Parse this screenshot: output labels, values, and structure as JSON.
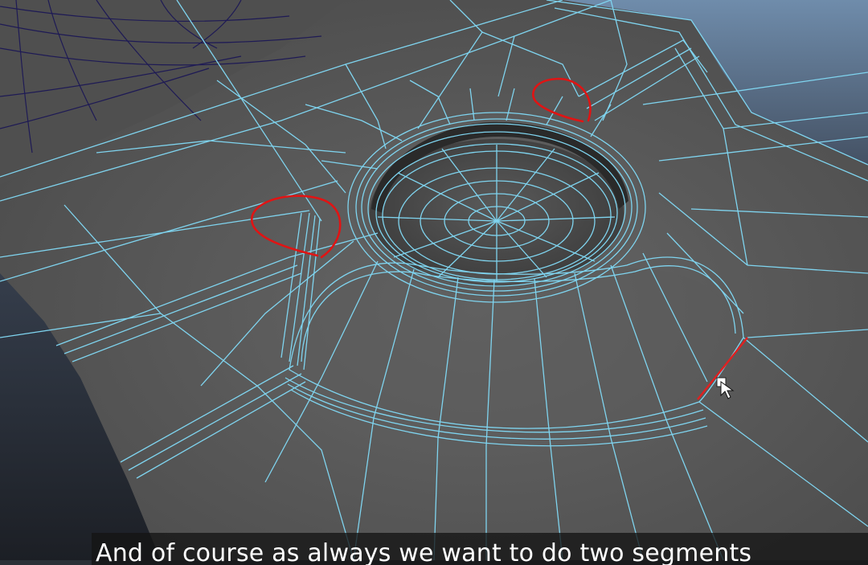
{
  "scene": {
    "description_free": true,
    "colors": {
      "background_top": "#6f8cab",
      "background_bottom": "#1c1f25",
      "mesh_surface": "#555555",
      "mesh_highlight": "#6a6a6a",
      "wireframe_selected": "#7fd4ef",
      "wireframe_unselected": "#1e1a55",
      "annotation": "#e01414",
      "selected_edge": "#e02020"
    }
  },
  "cursor": {
    "icon": "arrow-cursor-with-square-icon"
  },
  "subtitle": {
    "text": "And of course as always we want to do two segments"
  }
}
